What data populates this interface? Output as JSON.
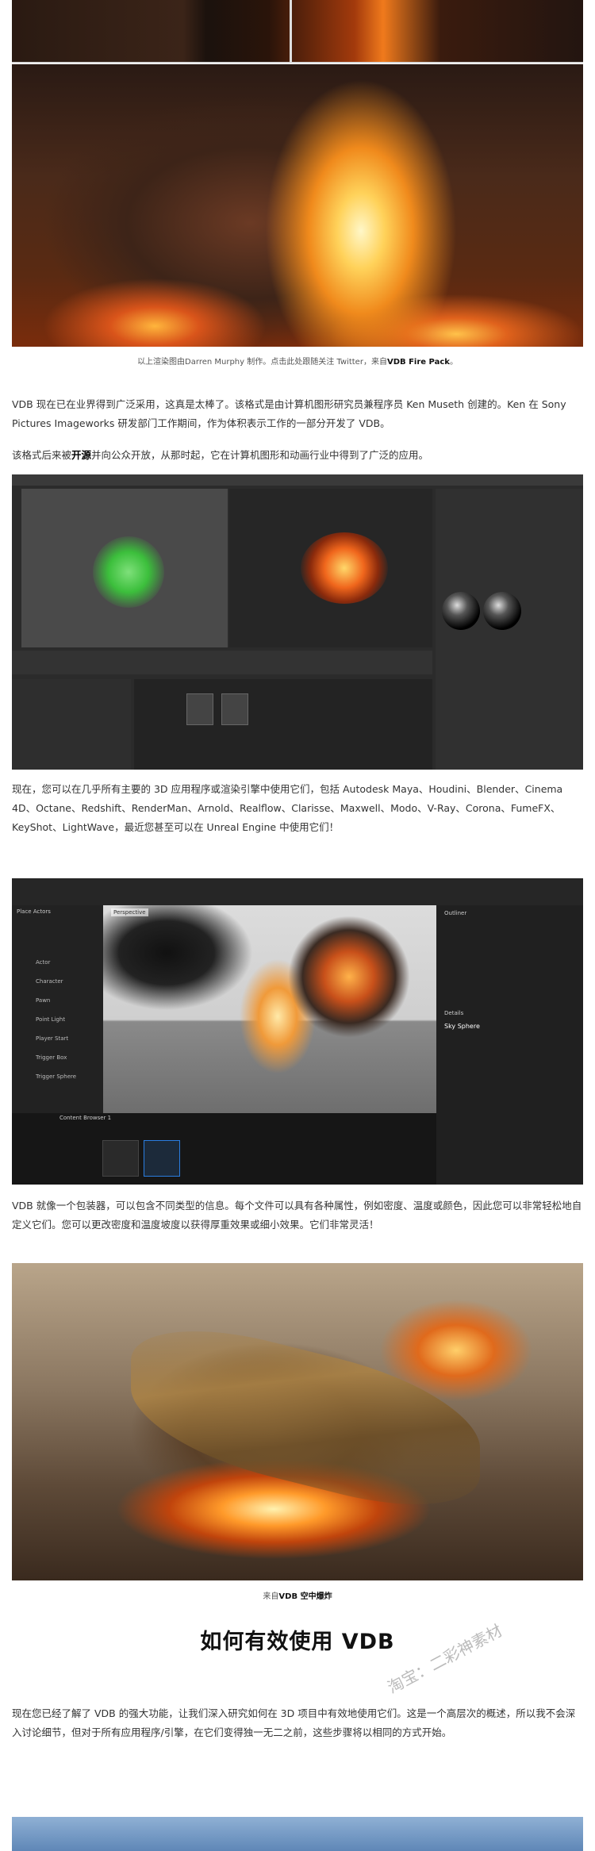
{
  "caption_1": {
    "prefix": "以上渲染图由Darren Murphy 制作。点击此处跟随关注 Twitter，来自",
    "highlight": "VDB Fire Pack",
    "suffix": "。"
  },
  "paragraph_1": "VDB 现在已在业界得到广泛采用，这真是太棒了。该格式是由计算机图形研究员兼程序员 Ken Museth 创建的。Ken 在 Sony Pictures Imageworks 研发部门工作期间，作为体积表示工作的一部分开发了 VDB。",
  "paragraph_2": {
    "prefix": "该格式后来被",
    "highlight": "开源",
    "suffix": "并向公众开放，从那时起，它在计算机图形和动画行业中得到了广泛的应用。"
  },
  "paragraph_3": "现在，您可以在几乎所有主要的 3D 应用程序或渲染引擎中使用它们，包括 Autodesk Maya、Houdini、Blender、Cinema 4D、Octane、Redshift、RenderMan、Arnold、Realflow、Clarisse、Maxwell、Modo、V-Ray、Corona、FumeFX、KeyShot、LightWave，最近您甚至可以在 Unreal Engine 中使用它们！",
  "paragraph_4": "VDB 就像一个包装器，可以包含不同类型的信息。每个文件可以具有各种属性，例如密度、温度或颜色，因此您可以非常轻松地自定义它们。您可以更改密度和温度坡度以获得厚重效果或细小效果。它们非常灵活！",
  "caption_2": {
    "prefix": "来自",
    "highlight": "VDB 空中爆炸",
    "suffix": ""
  },
  "section_heading": "如何有效使用 VDB",
  "paragraph_5": "现在您已经了解了 VDB 的强大功能，让我们深入研究如何在 3D 项目中有效地使用它们。这是一个高层次的概述，所以我不会深入讨论细节，但对于所有应用程序/引擎，在它们变得独一无二之前，这些步骤将以相同的方式开始。",
  "watermark": "淘宝：二彩神素材",
  "app2_labels": {
    "outliner": "Outliner",
    "details": "Details",
    "sky_sphere": "Sky Sphere",
    "place_actors": "Place Actors",
    "perspective": "Perspective",
    "content_browser": "Content Browser 1",
    "actor_items": [
      "Actor",
      "Character",
      "Pawn",
      "Point Light",
      "Player Start",
      "Trigger Box",
      "Trigger Sphere"
    ]
  },
  "colors": {
    "accent_blue": "#2a7de0",
    "text": "#333333",
    "heading": "#111111"
  }
}
